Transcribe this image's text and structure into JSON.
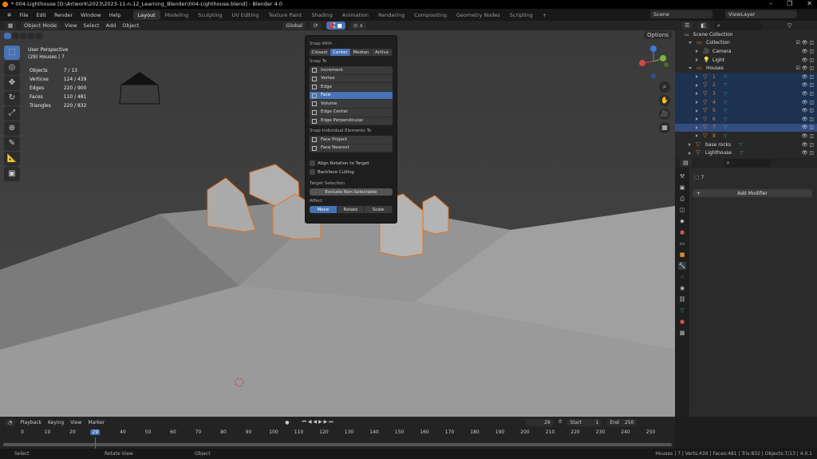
{
  "title": "* 004-Lighthouse [D:\\Artwork\\2023\\2023-11-n-12_Learning_Blender\\004-Lighthouse.blend] - Blender 4.0",
  "menu": [
    "File",
    "Edit",
    "Render",
    "Window",
    "Help"
  ],
  "workspaces": [
    "Layout",
    "Modeling",
    "Sculpting",
    "UV Editing",
    "Texture Paint",
    "Shading",
    "Animation",
    "Rendering",
    "Compositing",
    "Geometry Nodes",
    "Scripting",
    "+"
  ],
  "scene": "Scene",
  "view_layer": "ViewLayer",
  "header3d": {
    "mode": "Object Mode",
    "menus": [
      "View",
      "Select",
      "Add",
      "Object"
    ],
    "orientation": "Global",
    "options": "Options"
  },
  "overlay": {
    "view": "User Perspective",
    "context": "(29) Houses | 7"
  },
  "stats": [
    [
      "Objects",
      "7 / 13"
    ],
    [
      "Vertices",
      "124 / 439"
    ],
    [
      "Edges",
      "220 / 900"
    ],
    [
      "Faces",
      "110 / 481"
    ],
    [
      "Triangles",
      "220 / 832"
    ]
  ],
  "snap": {
    "snap_with_label": "Snap With",
    "snap_with": [
      "Closest",
      "Center",
      "Median",
      "Active"
    ],
    "snap_with_active": 1,
    "snap_to_label": "Snap To",
    "snap_to": [
      "Increment",
      "Vertex",
      "Edge",
      "Face",
      "Volume",
      "Edge Center",
      "Edge Perpendicular"
    ],
    "snap_to_active": 3,
    "individual_label": "Snap Individual Elements To",
    "individual": [
      "Face Project",
      "Face Nearest"
    ],
    "align_rotation": "Align Rotation to Target",
    "backface": "Backface Culling",
    "target_label": "Target Selection",
    "target_btn": "Exclude Non-Selectable",
    "affect_label": "Affect",
    "affect": [
      "Move",
      "Rotate",
      "Scale"
    ],
    "affect_active": 0
  },
  "outliner": {
    "root": "Scene Collection",
    "rows": [
      {
        "name": "Collection",
        "depth": 1,
        "type": "coll"
      },
      {
        "name": "Camera",
        "depth": 2,
        "type": "cam"
      },
      {
        "name": "Light",
        "depth": 2,
        "type": "light"
      },
      {
        "name": "Houses",
        "depth": 1,
        "type": "coll"
      },
      {
        "name": "1",
        "depth": 2,
        "type": "mesh",
        "sel": true
      },
      {
        "name": "2",
        "depth": 2,
        "type": "mesh",
        "sel": true
      },
      {
        "name": "3",
        "depth": 2,
        "type": "mesh",
        "sel": true
      },
      {
        "name": "4",
        "depth": 2,
        "type": "mesh",
        "sel": true
      },
      {
        "name": "5",
        "depth": 2,
        "type": "mesh",
        "sel": true
      },
      {
        "name": "6",
        "depth": 2,
        "type": "mesh",
        "sel": true
      },
      {
        "name": "7",
        "depth": 2,
        "type": "mesh",
        "act": true
      },
      {
        "name": "8",
        "depth": 2,
        "type": "mesh"
      },
      {
        "name": "base rocks",
        "depth": 1,
        "type": "mesh"
      },
      {
        "name": "Lighthouse",
        "depth": 1,
        "type": "mesh"
      }
    ]
  },
  "properties": {
    "object": "7",
    "add_modifier": "Add Modifier"
  },
  "timeline": {
    "menus": [
      "Playback",
      "Keying",
      "View",
      "Marker"
    ],
    "current": "29",
    "start_label": "Start",
    "start": "1",
    "end_label": "End",
    "end": "250",
    "ticks": [
      "0",
      "10",
      "20",
      "29",
      "40",
      "50",
      "60",
      "70",
      "80",
      "90",
      "100",
      "110",
      "120",
      "130",
      "140",
      "150",
      "160",
      "170",
      "180",
      "190",
      "200",
      "210",
      "220",
      "230",
      "240",
      "250"
    ]
  },
  "status": {
    "left": [
      "Select",
      "Rotate View",
      "Object"
    ],
    "right": "Houses | 7 | Verts:439 | Faces:481 | Tris:832 | Objects:7/13 | 4.0.1"
  }
}
